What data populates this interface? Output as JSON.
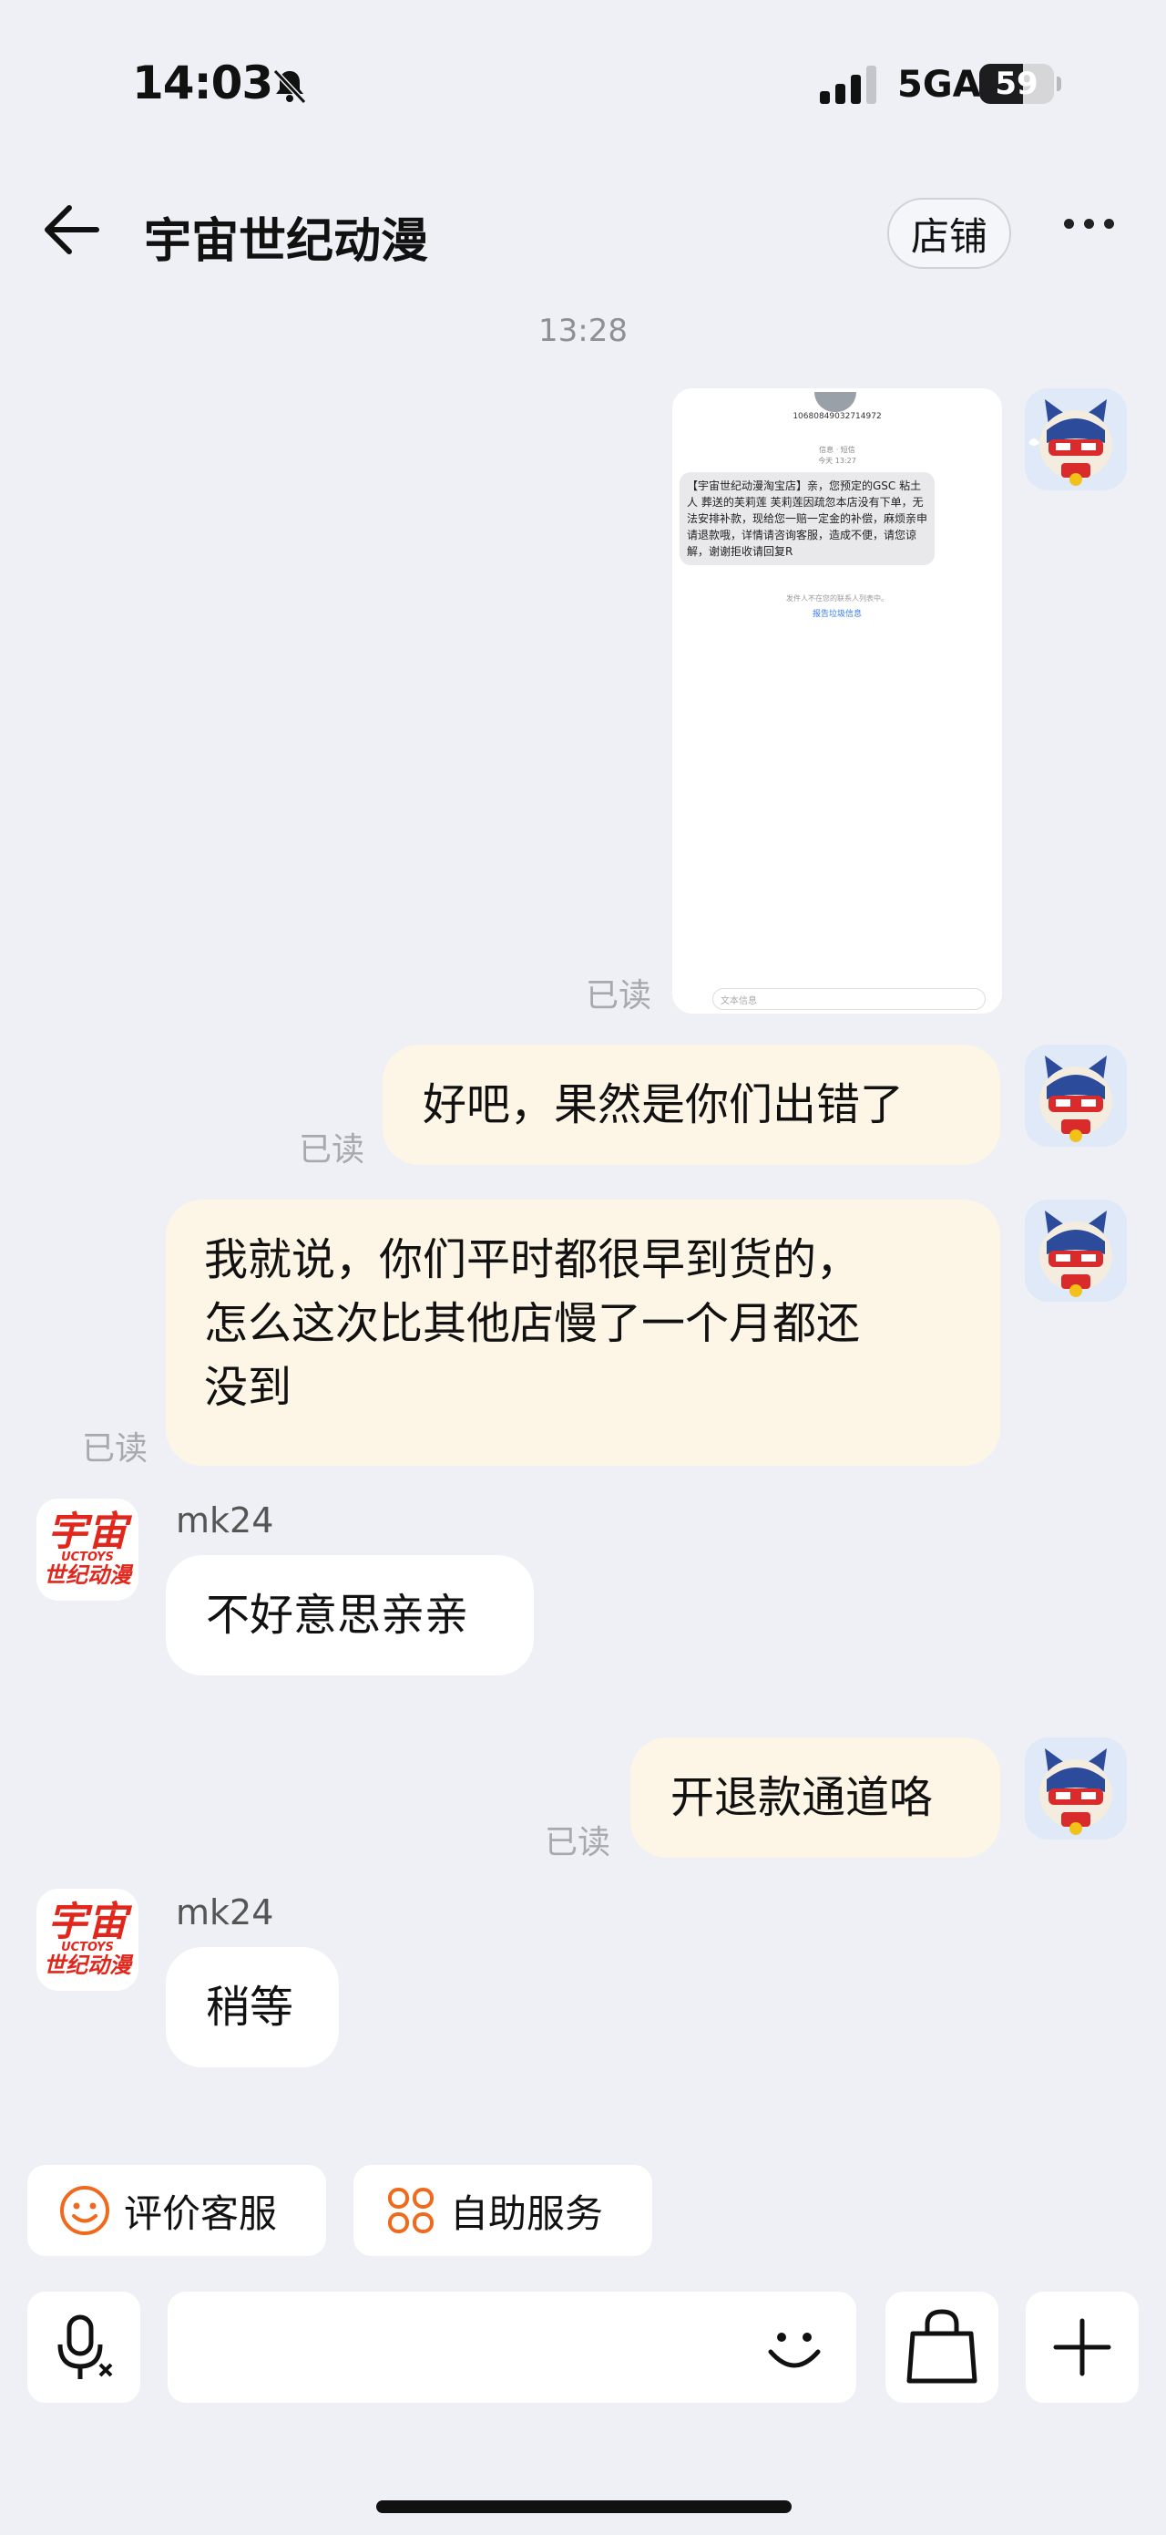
{
  "status": {
    "time": "14:03",
    "network": "5GA",
    "battery": "59",
    "battery_level": 0.59
  },
  "header": {
    "title": "宇宙世纪动漫",
    "shop_label": "店铺"
  },
  "timestamp": "13:28",
  "image_message": {
    "sender_number": "10680849032714972",
    "meta_line1": "信息 · 短信",
    "meta_line2": "今天 13:27",
    "sms_text": "【宇宙世纪动漫淘宝店】亲，您预定的GSC 粘土人 葬送的芙莉莲 芙莉莲因疏忽本店没有下单，无法安排补款，现给您一赔一定金的补偿，麻烦亲申请退款哦，详情请咨询客服，造成不便，请您谅解，谢谢拒收请回复R",
    "unknown_sender_note": "发件人不在您的联系人列表中。",
    "report_link": "报告垃圾信息",
    "input_placeholder": "文本信息"
  },
  "messages": [
    {
      "from": "me",
      "text": "好吧，果然是你们出错了",
      "status": "已读"
    },
    {
      "from": "me",
      "lines": [
        "我就说，你们平时都很早到货的，",
        "怎么这次比其他店慢了一个月都还",
        "没到"
      ],
      "status": "已读"
    },
    {
      "from": "shop",
      "sender": "mk24",
      "text": "不好意思亲亲"
    },
    {
      "from": "me",
      "text": "开退款通道咯",
      "status": "已读"
    },
    {
      "from": "shop",
      "sender": "mk24",
      "text": "稍等"
    }
  ],
  "read_label": "已读",
  "shop_avatar": {
    "line1": "宇宙",
    "line2": "UCTOYS",
    "line3": "世纪动漫"
  },
  "quick_actions": [
    {
      "label": "评价客服",
      "icon": "smiley-icon"
    },
    {
      "label": "自助服务",
      "icon": "grid-icon"
    }
  ],
  "colors": {
    "accent": "#f06a1d",
    "outgoing_bubble": "#fdf5e6",
    "background": "#eef0f5"
  }
}
